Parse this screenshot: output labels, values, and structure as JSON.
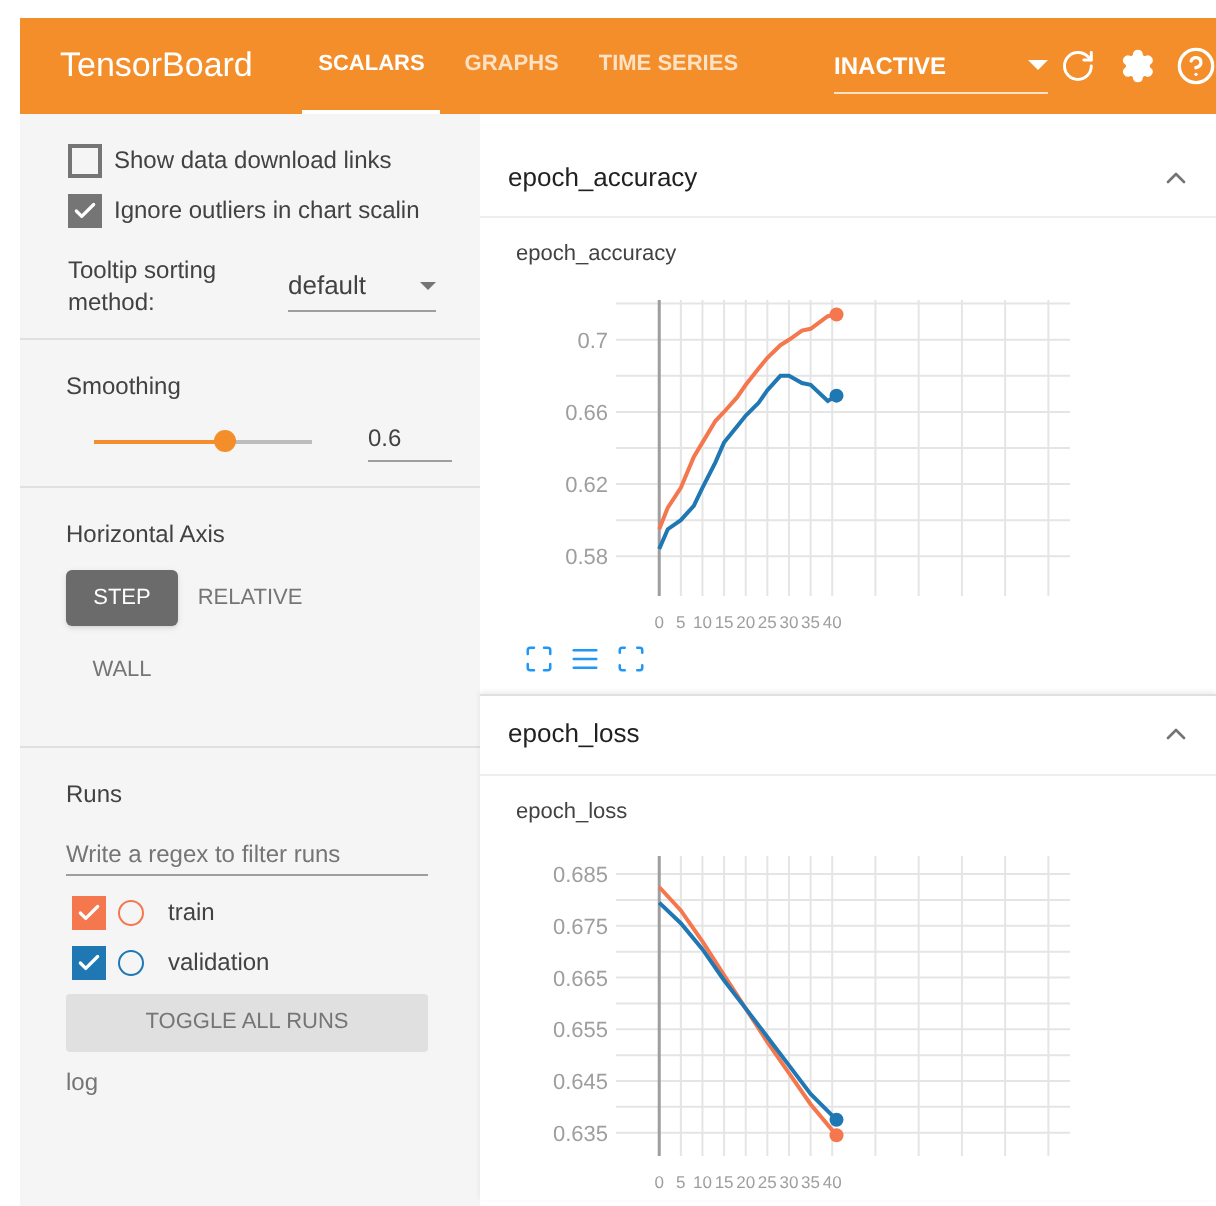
{
  "app_title": "TensorBoard",
  "tabs": [
    {
      "label": "SCALARS",
      "selected": true
    },
    {
      "label": "GRAPHS",
      "selected": false
    },
    {
      "label": "TIME SERIES",
      "selected": false
    }
  ],
  "run_status_dropdown": {
    "value": "INACTIVE"
  },
  "options": [
    {
      "label": "Show data download links",
      "checked": false
    },
    {
      "label": "Ignore outliers in chart scalin",
      "checked": true
    }
  ],
  "tooltip_sorting": {
    "label": "Tooltip sorting method:",
    "value": "default"
  },
  "smoothing": {
    "label": "Smoothing",
    "level": 0.6,
    "value": "0.6"
  },
  "horizontal_axis": {
    "label": "Horizontal Axis",
    "options": [
      {
        "label": "STEP",
        "selected": true
      },
      {
        "label": "RELATIVE",
        "selected": false
      },
      {
        "label": "WALL",
        "selected": false
      }
    ]
  },
  "runs": {
    "label": "Runs",
    "placeholder": "Write a regex to filter runs",
    "items": [
      {
        "name": "train",
        "checked": true,
        "color": "#f4774e"
      },
      {
        "name": "validation",
        "checked": true,
        "color": "#1f77b4"
      }
    ],
    "toggle_button": "TOGGLE ALL RUNS",
    "footer": "log"
  },
  "cards": [
    {
      "title": "epoch_accuracy",
      "expanded": true,
      "chart_title": "epoch_accuracy",
      "show_tools": true,
      "chart_data": {
        "type": "line",
        "x": [
          0,
          2,
          5,
          8,
          10,
          13,
          15,
          18,
          20,
          23,
          25,
          28,
          30,
          33,
          35,
          39,
          41
        ],
        "grid": true,
        "xlim": [
          -10,
          95
        ],
        "ylim": [
          0.558,
          0.722
        ],
        "xticks": [
          0,
          5,
          10,
          15,
          20,
          25,
          30,
          35,
          40
        ],
        "yticks": [
          0.58,
          0.62,
          0.66,
          0.7
        ],
        "series": [
          {
            "color": "#f4774e",
            "values": [
              0.595,
              0.607,
              0.618,
              0.635,
              0.643,
              0.655,
              0.66,
              0.668,
              0.675,
              0.684,
              0.69,
              0.697,
              0.7,
              0.705,
              0.706,
              0.713,
              0.714
            ]
          },
          {
            "color": "#1f77b4",
            "values": [
              0.584,
              0.595,
              0.6,
              0.608,
              0.618,
              0.632,
              0.643,
              0.652,
              0.658,
              0.665,
              0.672,
              0.68,
              0.68,
              0.676,
              0.675,
              0.666,
              0.669
            ]
          }
        ]
      }
    },
    {
      "title": "epoch_loss",
      "expanded": true,
      "chart_title": "epoch_loss",
      "show_tools": false,
      "chart_data": {
        "type": "line",
        "x": [
          0,
          5,
          10,
          15,
          20,
          25,
          30,
          35,
          41
        ],
        "grid": true,
        "xlim": [
          -10,
          95
        ],
        "ylim": [
          0.6305,
          0.6885
        ],
        "xticks": [
          0,
          5,
          10,
          15,
          20,
          25,
          30,
          35,
          40
        ],
        "yticks": [
          0.635,
          0.645,
          0.655,
          0.665,
          0.675,
          0.685
        ],
        "series": [
          {
            "color": "#f4774e",
            "values": [
              0.6825,
              0.678,
              0.672,
              0.6655,
              0.659,
              0.6525,
              0.6465,
              0.6405,
              0.6345
            ]
          },
          {
            "color": "#1f77b4",
            "values": [
              0.6795,
              0.6755,
              0.6705,
              0.6645,
              0.659,
              0.6535,
              0.648,
              0.6425,
              0.6375
            ]
          }
        ]
      }
    }
  ]
}
